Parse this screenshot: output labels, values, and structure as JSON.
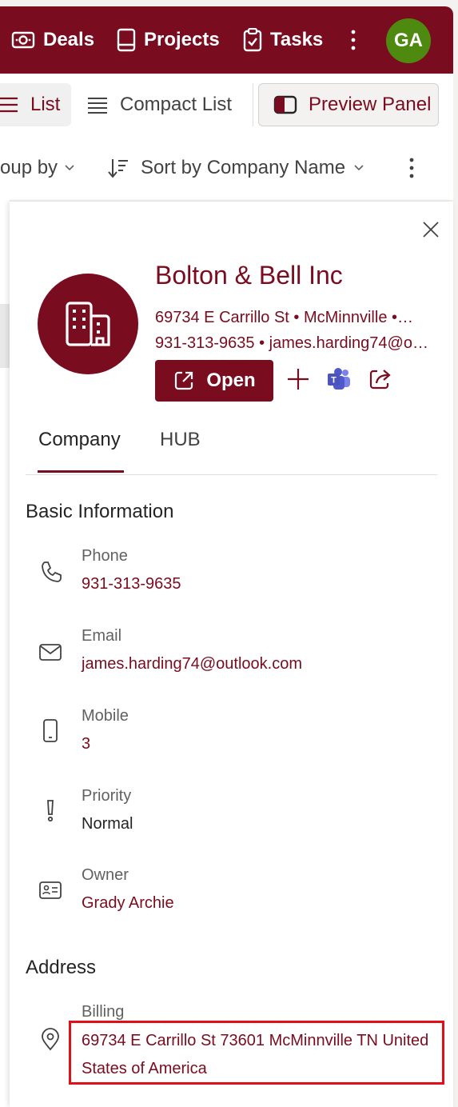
{
  "nav": {
    "deals": "Deals",
    "projects": "Projects",
    "tasks": "Tasks",
    "avatar_initials": "GA",
    "avatar_color": "#4e8a10",
    "brand_color": "#7a0c1f"
  },
  "views": {
    "list": "List",
    "compact_list": "Compact List",
    "preview_panel": "Preview Panel"
  },
  "toolbar": {
    "group_by": "oup by",
    "sort_by": "Sort by Company Name"
  },
  "company": {
    "name": "Bolton & Bell Inc",
    "meta_line1": "69734 E Carrillo St  •  McMinnville  •…",
    "meta_line2": "931-313-9635  •  james.harding74@o…",
    "open_label": "Open"
  },
  "tabs": [
    "Company",
    "HUB"
  ],
  "basic_info": {
    "title": "Basic Information",
    "phone_label": "Phone",
    "phone_value": "931-313-9635",
    "email_label": "Email",
    "email_value": "james.harding74@outlook.com",
    "mobile_label": "Mobile",
    "mobile_value": "3",
    "priority_label": "Priority",
    "priority_value": "Normal",
    "owner_label": "Owner",
    "owner_value": "Grady Archie"
  },
  "address": {
    "title": "Address",
    "billing_label": "Billing",
    "billing_value": "69734 E Carrillo St 73601 McMinnville TN United States of America"
  },
  "icons": [
    "deals-icon",
    "projects-icon",
    "tasks-icon",
    "more-icon",
    "list-icon",
    "compact-list-icon",
    "preview-panel-icon",
    "sort-icon",
    "chevron-down-icon",
    "close-icon",
    "building-icon",
    "open-external-icon",
    "add-icon",
    "teams-icon",
    "share-icon",
    "phone-icon",
    "mail-icon",
    "mobile-icon",
    "priority-icon",
    "contact-card-icon",
    "location-icon"
  ]
}
